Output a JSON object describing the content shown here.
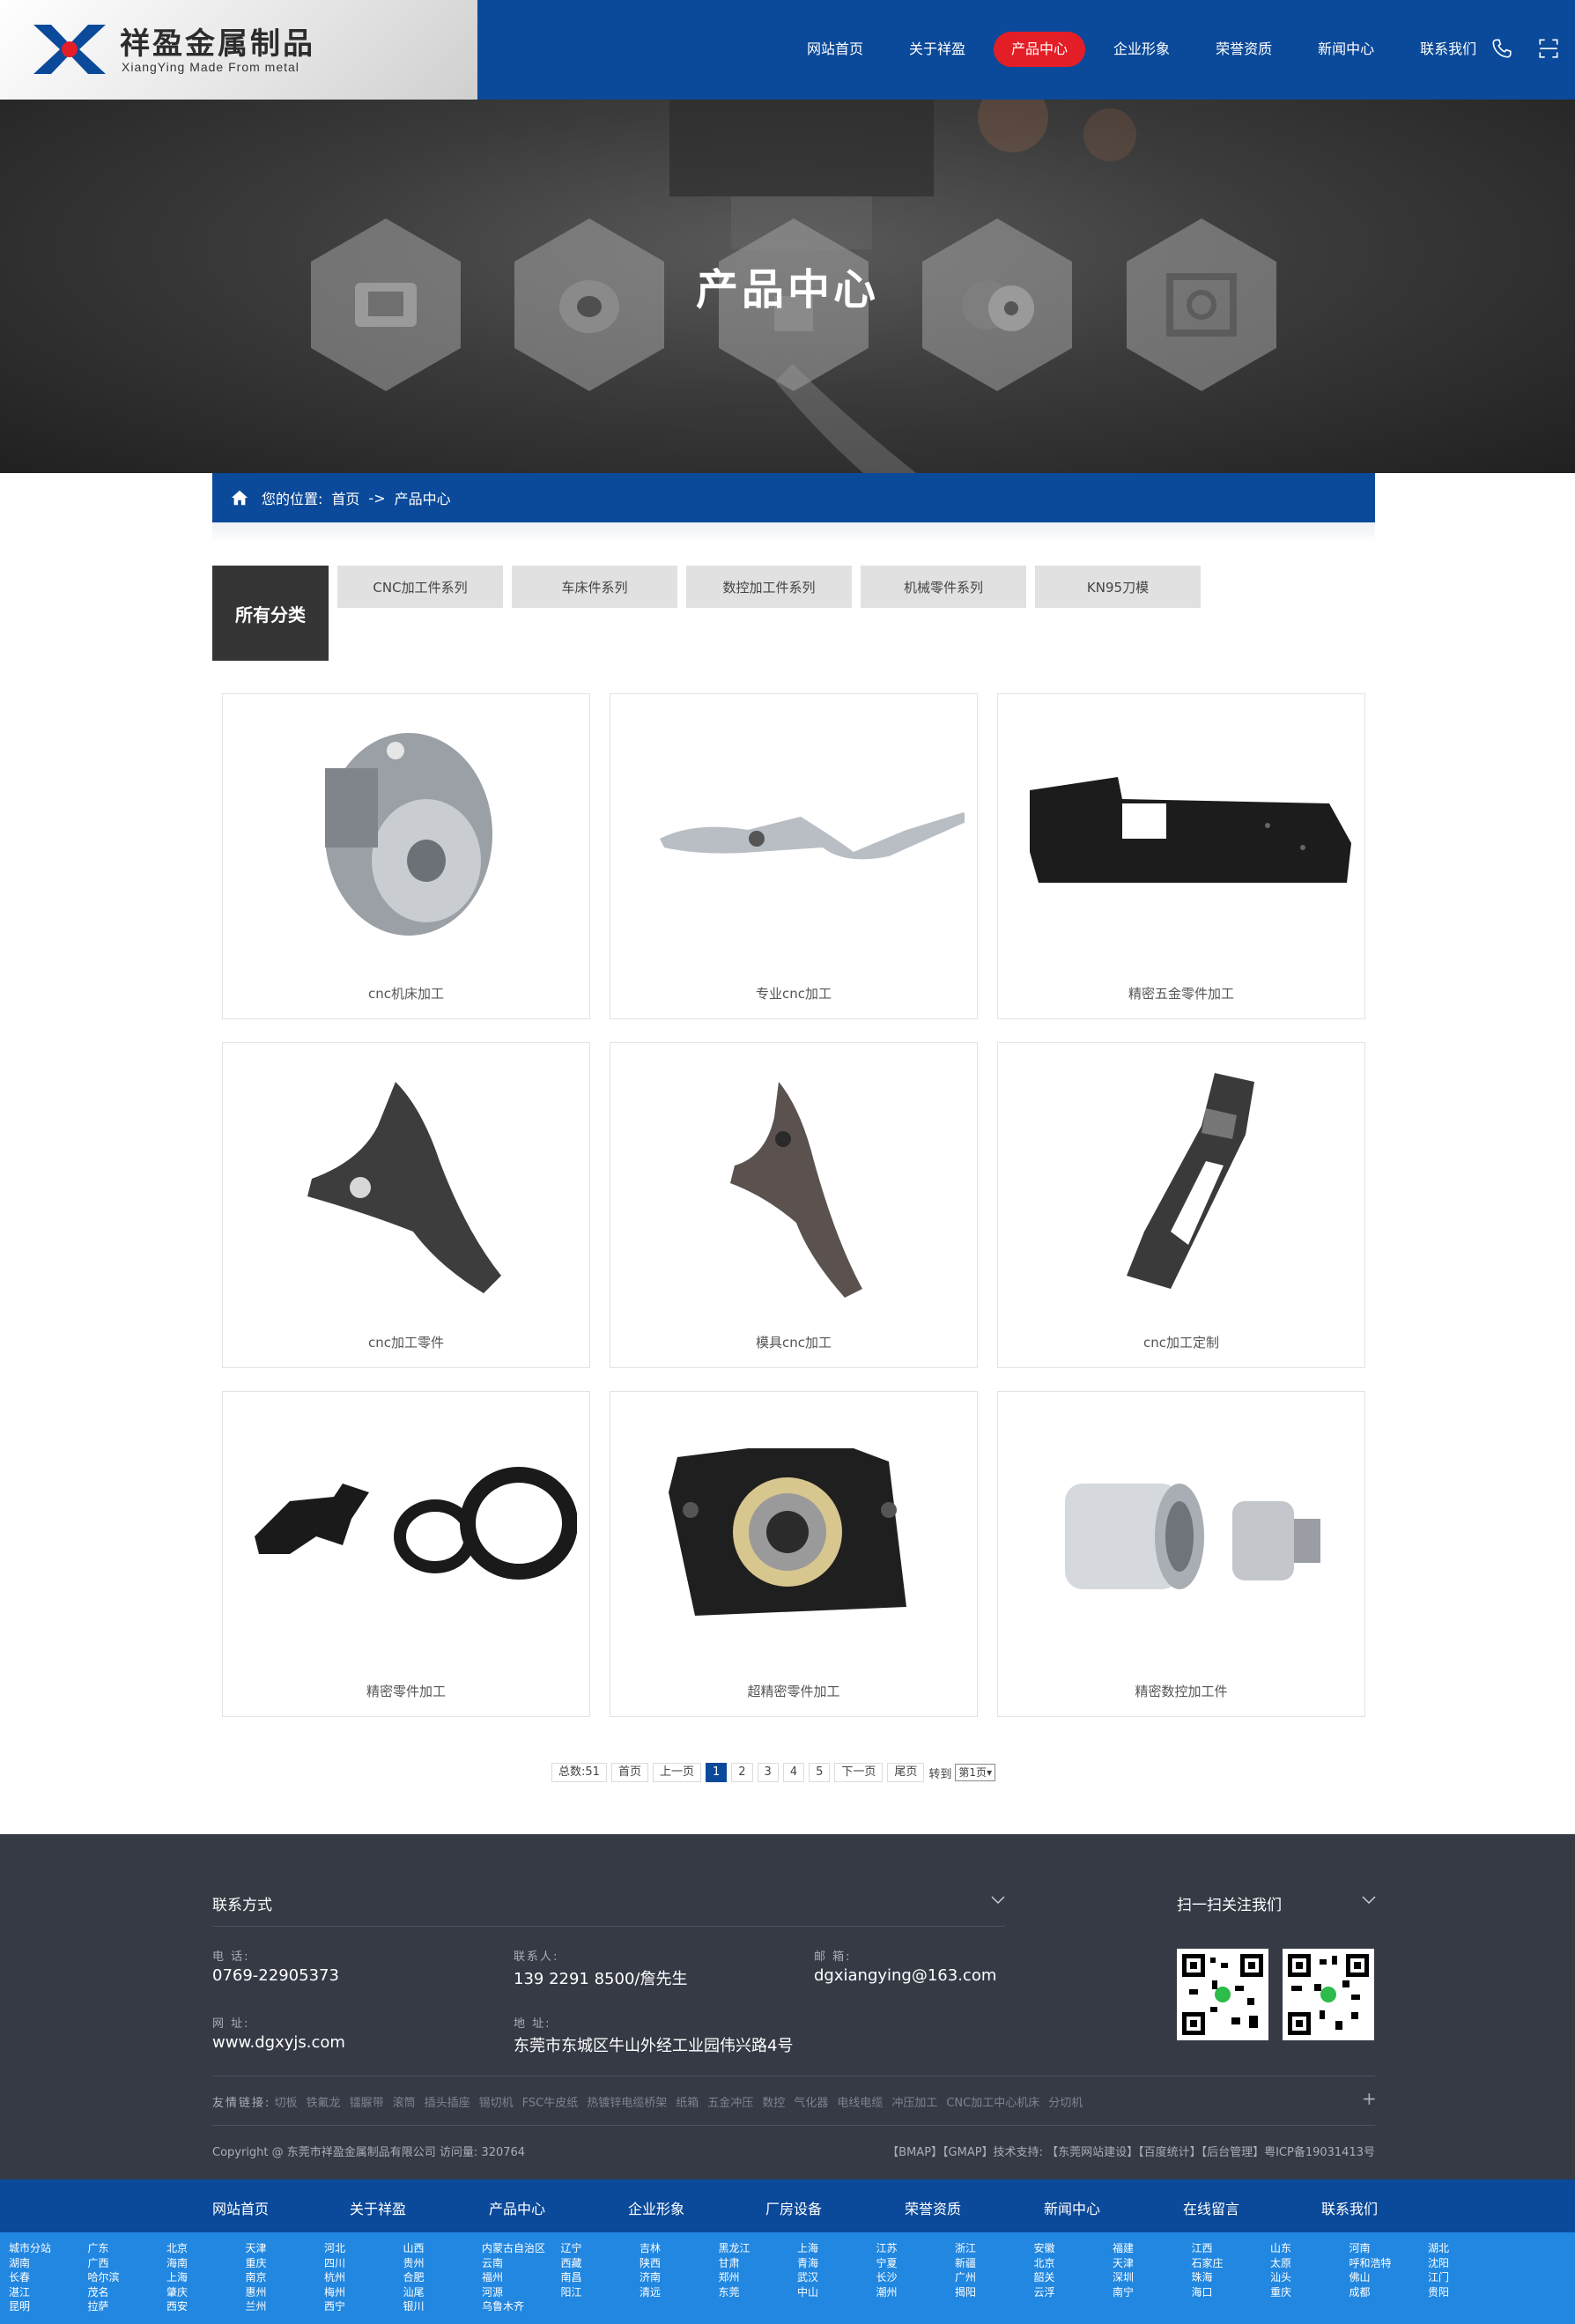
{
  "header": {
    "logo_title": "祥盈金属制品",
    "logo_sub": "XiangYing Made From metal",
    "nav": [
      "网站首页",
      "关于祥盈",
      "产品中心",
      "企业形象",
      "荣誉资质",
      "新闻中心",
      "联系我们"
    ],
    "active_index": 2,
    "accent_color": "#e41e26",
    "brand_color": "#0b4a9a",
    "icons": [
      "phone-icon",
      "qr-scan-icon"
    ]
  },
  "banner": {
    "title": "产品中心"
  },
  "breadcrumb": {
    "prefix": "您的位置:",
    "home": "首页",
    "sep": "->",
    "current": "产品中心"
  },
  "categories": {
    "all_label": "所有分类",
    "tabs": [
      "CNC加工件系列",
      "车床件系列",
      "数控加工件系列",
      "机械零件系列",
      "KN95刀模"
    ]
  },
  "products": [
    {
      "label": "cnc机床加工",
      "image": "silver-machined-housing"
    },
    {
      "label": "专业cnc加工",
      "image": "polished-lever-arm"
    },
    {
      "label": "精密五金零件加工",
      "image": "black-bracket-plate"
    },
    {
      "label": "cnc加工零件",
      "image": "triangular-control-arm"
    },
    {
      "label": "模具cnc加工",
      "image": "curved-arm-part"
    },
    {
      "label": "cnc加工定制",
      "image": "frame-handle-part"
    },
    {
      "label": "精密零件加工",
      "image": "black-clip-and-rings"
    },
    {
      "label": "超精密零件加工",
      "image": "black-bearing-block"
    },
    {
      "label": "精密数控加工件",
      "image": "silver-cylinders"
    }
  ],
  "pagination": {
    "total": "总数:51",
    "first": "首页",
    "prev": "上一页",
    "pages": [
      "1",
      "2",
      "3",
      "4",
      "5"
    ],
    "current": "1",
    "next": "下一页",
    "last": "尾页",
    "goto": "转到",
    "select": "第1页"
  },
  "footer": {
    "contact_title": "联系方式",
    "follow_title": "扫一扫关注我们",
    "phone_label": "电 话:",
    "phone": "0769-22905373",
    "contact_label": "联系人:",
    "contact": "139 2291 8500/詹先生",
    "email_label": "邮 箱:",
    "email": "dgxiangying@163.com",
    "site_label": "网 址:",
    "site": "www.dgxyjs.com",
    "addr_label": "地 址:",
    "addr": "东莞市东城区牛山外经工业园伟兴路4号",
    "links_label": "友情链接:",
    "links": [
      "切板",
      "铁氟龙",
      "镭脲带",
      "滚筒",
      "插头插座",
      "锡切机",
      "FSC牛皮纸",
      "热镀锌电缆桥架",
      "纸箱",
      "五金冲压",
      "数控",
      "气化器",
      "电线电缆",
      "冲压加工",
      "CNC加工中心机床",
      "分切机"
    ],
    "copyright": "Copyright @ 东莞市祥盈金属制品有限公司 访问量: 320764",
    "right_links": "【BMAP】【GMAP】技术支持: 【东莞网站建设】【百度统计】【后台管理】粤ICP备19031413号"
  },
  "footer_nav": [
    "网站首页",
    "关于祥盈",
    "产品中心",
    "企业形象",
    "厂房设备",
    "荣誉资质",
    "新闻中心",
    "在线留言",
    "联系我们"
  ],
  "cities": [
    [
      "城市分站",
      "湖南",
      "长春",
      "湛江",
      "昆明"
    ],
    [
      "广东",
      "广西",
      "哈尔滨",
      "茂名",
      "拉萨"
    ],
    [
      "北京",
      "海南",
      "上海",
      "肇庆",
      "西安"
    ],
    [
      "天津",
      "重庆",
      "南京",
      "惠州",
      "兰州"
    ],
    [
      "河北",
      "四川",
      "杭州",
      "梅州",
      "西宁"
    ],
    [
      "山西",
      "贵州",
      "合肥",
      "汕尾",
      "银川"
    ],
    [
      "内蒙古自治区",
      "云南",
      "福州",
      "河源",
      "乌鲁木齐"
    ],
    [
      "辽宁",
      "西藏",
      "南昌",
      "阳江"
    ],
    [
      "吉林",
      "陕西",
      "济南",
      "清远"
    ],
    [
      "黑龙江",
      "甘肃",
      "郑州",
      "东莞"
    ],
    [
      "上海",
      "青海",
      "武汉",
      "中山"
    ],
    [
      "江苏",
      "宁夏",
      "长沙",
      "潮州"
    ],
    [
      "浙江",
      "新疆",
      "广州",
      "揭阳"
    ],
    [
      "安徽",
      "北京",
      "韶关",
      "云浮"
    ],
    [
      "福建",
      "天津",
      "深圳",
      "南宁"
    ],
    [
      "江西",
      "石家庄",
      "珠海",
      "海口"
    ],
    [
      "山东",
      "太原",
      "汕头",
      "重庆"
    ],
    [
      "河南",
      "呼和浩特",
      "佛山",
      "成都"
    ],
    [
      "湖北",
      "沈阳",
      "江门",
      "贵阳"
    ]
  ]
}
